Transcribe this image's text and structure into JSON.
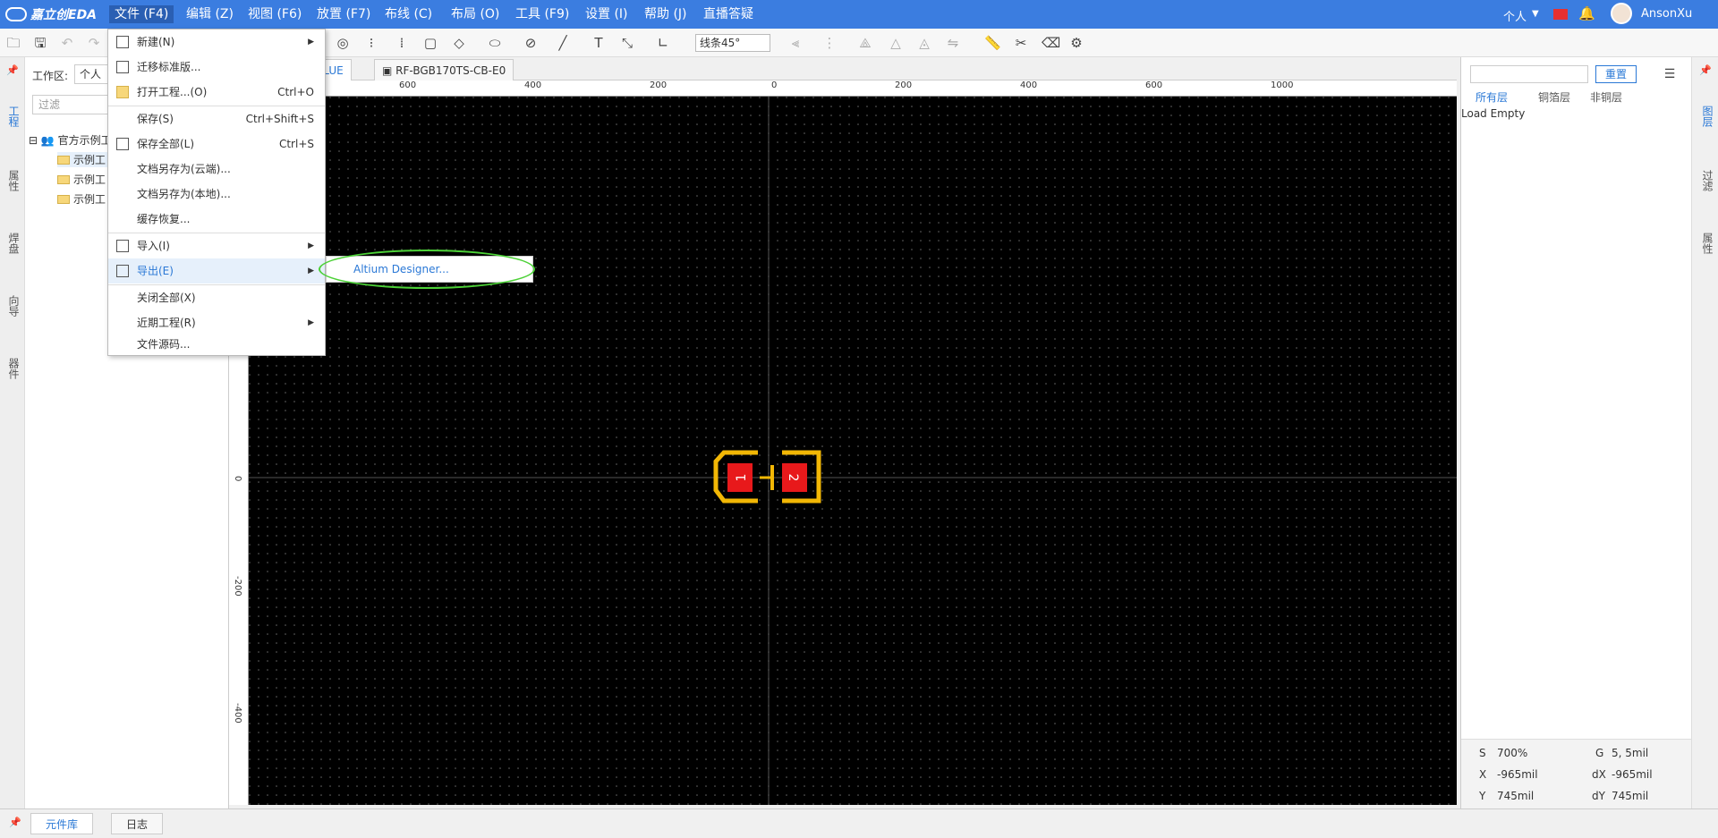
{
  "menubar": {
    "logo": "嘉立创EDA",
    "items": [
      "文件 (F4)",
      "编辑 (Z)",
      "视图 (F6)",
      "放置 (F7)",
      "布线 (C)",
      "布局 (O)",
      "工具 (F9)",
      "设置 (I)",
      "帮助 (J)",
      "直播答疑"
    ],
    "account_label": "个人",
    "username": "AnsonXu"
  },
  "toolbar": {
    "line_select": "线条45°"
  },
  "left_rail": [
    "工程",
    "属性",
    "焊盘",
    "向导",
    "器件"
  ],
  "left_panel": {
    "workspace_label": "工作区:",
    "workspace_value": "个人",
    "filter_placeholder": "过滤",
    "tree_root": "官方示例工",
    "tree_items": [
      "示例工",
      "示例工",
      "示例工"
    ]
  },
  "doc_tabs": [
    "_BLUE",
    "RF-BGB170TS-CB-E0"
  ],
  "ruler_top": [
    "600",
    "400",
    "200",
    "0",
    "200",
    "400",
    "600",
    "1000"
  ],
  "ruler_left": [
    "0",
    "-200",
    "-400"
  ],
  "pads": [
    "1",
    "2"
  ],
  "right_panel": {
    "reset_label": "重置",
    "layer_tabs": [
      "所有层",
      "铜箔层",
      "非铜层"
    ],
    "load_text": "Load Empty",
    "status": {
      "s_label": "S",
      "s_value": "700%",
      "g_label": "G",
      "g_value": "5, 5mil",
      "x_label": "X",
      "x_value": "-965mil",
      "dx_label": "dX",
      "dx_value": "-965mil",
      "y_label": "Y",
      "y_value": "745mil",
      "dy_label": "dY",
      "dy_value": "745mil"
    }
  },
  "right_rail": [
    "图层",
    "过滤",
    "属性"
  ],
  "bottom_tabs": [
    "元件库",
    "日志"
  ],
  "file_menu": {
    "items": [
      {
        "label": "新建(N)",
        "shortcut": "",
        "submenu": true
      },
      {
        "label": "迁移标准版...",
        "shortcut": "",
        "submenu": false
      },
      {
        "label": "打开工程...(O)",
        "shortcut": "Ctrl+O",
        "submenu": false
      },
      {
        "label": "保存(S)",
        "shortcut": "Ctrl+Shift+S",
        "submenu": false
      },
      {
        "label": "保存全部(L)",
        "shortcut": "Ctrl+S",
        "submenu": false
      },
      {
        "label": "文档另存为(云端)...",
        "shortcut": "",
        "submenu": false
      },
      {
        "label": "文档另存为(本地)...",
        "shortcut": "",
        "submenu": false
      },
      {
        "label": "缓存恢复...",
        "shortcut": "",
        "submenu": false
      },
      {
        "label": "导入(I)",
        "shortcut": "",
        "submenu": true
      },
      {
        "label": "导出(E)",
        "shortcut": "",
        "submenu": true
      },
      {
        "label": "关闭全部(X)",
        "shortcut": "",
        "submenu": false
      },
      {
        "label": "近期工程(R)",
        "shortcut": "",
        "submenu": true
      },
      {
        "label": "文件源码...",
        "shortcut": "",
        "submenu": false
      }
    ],
    "export_submenu": "Altium Designer..."
  },
  "colors": {
    "menubar": "#3b7de0",
    "accent": "#2a78d6",
    "pad": "#e8191b",
    "outline": "#f2b705",
    "highlight": "#4cd137"
  }
}
